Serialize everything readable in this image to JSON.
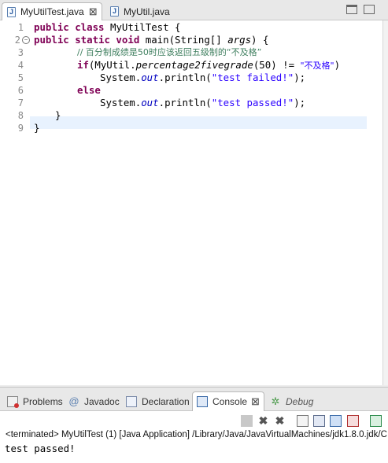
{
  "editor": {
    "tabs": [
      {
        "label": "MyUtilTest.java",
        "close": "⊠"
      },
      {
        "label": "MyUtil.java"
      }
    ],
    "line_numbers": [
      "1",
      "2",
      "3",
      "4",
      "5",
      "6",
      "7",
      "8",
      "9"
    ],
    "code": {
      "l1": {
        "kw": "public class",
        "rest": " MyUtilTest {"
      },
      "l2": {
        "kw1": "public static void",
        "rest": " main(String[] ",
        "arg": "args",
        "end": ") {"
      },
      "l3": {
        "comment": "// 百分制成绩是50时应该返回五级制的“不及格”"
      },
      "l4": {
        "kw": "if",
        "a": "(MyUtil.",
        "method": "percentage2fivegrade",
        "b": "(50) != ",
        "str": "\"不及格\"",
        "end": ")"
      },
      "l5": {
        "a": "System.",
        "field": "out",
        "b": ".println(",
        "str": "\"test failed!\"",
        "end": ");"
      },
      "l6": {
        "kw": "else"
      },
      "l7": {
        "a": "System.",
        "field": "out",
        "b": ".println(",
        "str": "\"test passed!\"",
        "end": ");"
      },
      "l8": {
        "text": "}"
      },
      "l9": {
        "text": "}"
      }
    }
  },
  "panel": {
    "tabs": [
      {
        "label": "Problems"
      },
      {
        "label": "Javadoc"
      },
      {
        "label": "Declaration"
      },
      {
        "label": "Console",
        "close": "⊠"
      },
      {
        "label": "Debug"
      }
    ],
    "status": "<terminated> MyUtilTest (1) [Java Application] /Library/Java/JavaVirtualMachines/jdk1.8.0.jdk/C",
    "output": "test passed!"
  },
  "colors": {
    "keyword": "#7f0055",
    "comment": "#3f7f5f",
    "string": "#2a00ff",
    "field": "#0000c0",
    "current_line": "#e8f2fe"
  }
}
